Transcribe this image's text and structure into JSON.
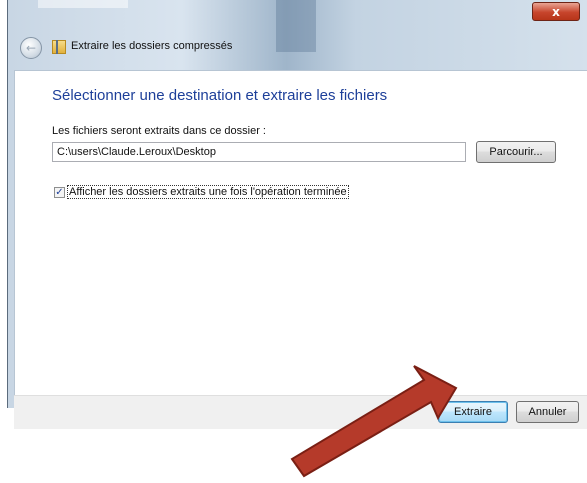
{
  "window": {
    "title": "Extraire les dossiers compressés",
    "close_label": "x"
  },
  "content": {
    "heading": "Sélectionner une destination et extraire les fichiers",
    "dest_label": "Les fichiers seront extraits dans ce dossier :",
    "dest_path": "C:\\users\\Claude.Leroux\\Desktop",
    "browse_label": "Parcourir...",
    "show_files_label": "Afficher les dossiers extraits une fois l'opération terminée",
    "show_files_checked": true
  },
  "footer": {
    "extract_label": "Extraire",
    "cancel_label": "Annuler"
  },
  "annotation": {
    "arrow_color": "#b53a2a"
  }
}
